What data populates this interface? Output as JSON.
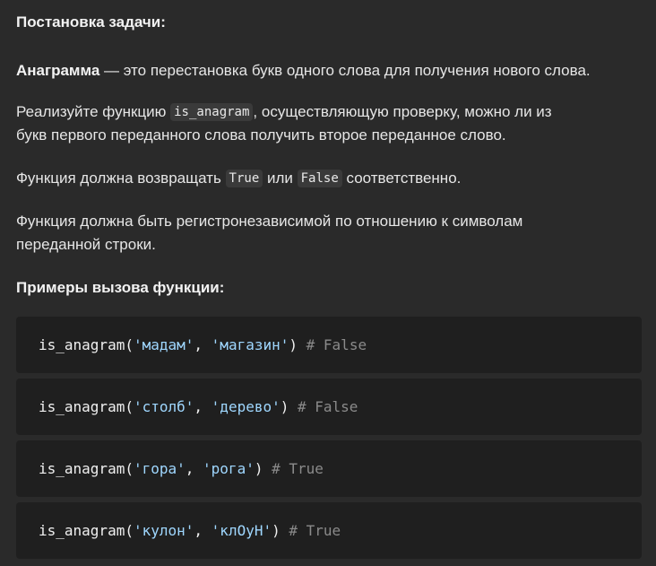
{
  "task_heading": "Постановка задачи:",
  "definition": {
    "term": "Анаграмма",
    "text": " — это перестановка букв одного слова для получения нового слова."
  },
  "implement": {
    "line1_before": "Реализуйте функцию ",
    "function_name": "is_anagram",
    "line1_after": ", осуществляющую проверку, можно ли из",
    "line2": "букв первого переданного слова получить второе переданное слово."
  },
  "return_values": {
    "before": "Функция должна возвращать ",
    "true_value": "True",
    "middle": " или ",
    "false_value": "False",
    "after": " соответственно."
  },
  "case_insensitive": {
    "line1": "Функция должна быть регистронезависимой по отношению к символам",
    "line2": "переданной строки."
  },
  "examples_heading": "Примеры вызова функции:",
  "examples": [
    {
      "fn": "is_anagram",
      "open": "(",
      "arg1": "'мадам'",
      "sep": ", ",
      "arg2": "'магазин'",
      "close": ")",
      "comment": " # False"
    },
    {
      "fn": "is_anagram",
      "open": "(",
      "arg1": "'столб'",
      "sep": ", ",
      "arg2": "'дерево'",
      "close": ")",
      "comment": " # False"
    },
    {
      "fn": "is_anagram",
      "open": "(",
      "arg1": "'гора'",
      "sep": ", ",
      "arg2": "'рога'",
      "close": ")",
      "comment": " # True"
    },
    {
      "fn": "is_anagram",
      "open": "(",
      "arg1": "'кулон'",
      "sep": ", ",
      "arg2": "'клОуН'",
      "close": ")",
      "comment": " # True"
    }
  ]
}
